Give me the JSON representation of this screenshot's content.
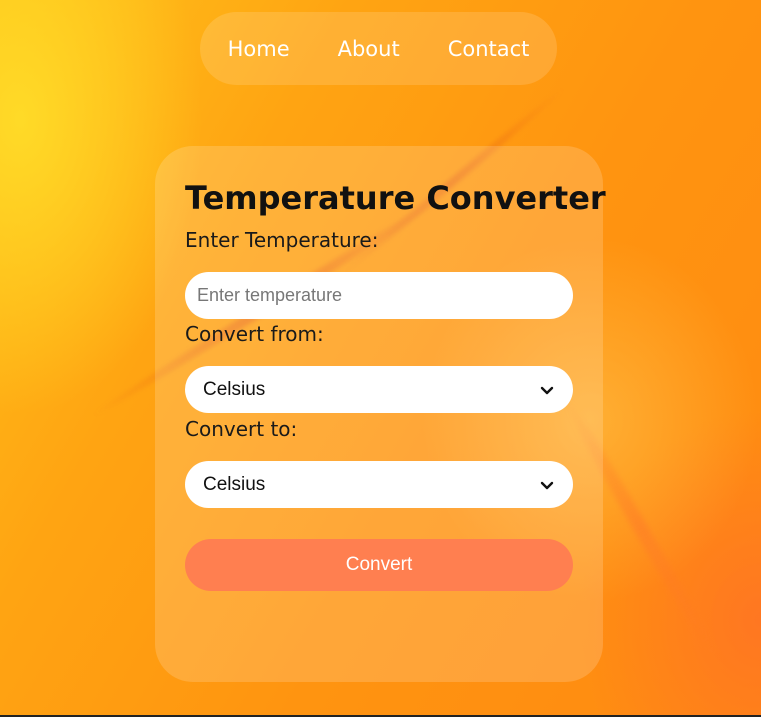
{
  "nav": {
    "items": [
      {
        "label": "Home"
      },
      {
        "label": "About"
      },
      {
        "label": "Contact"
      }
    ]
  },
  "converter": {
    "title": "Temperature Converter",
    "temperature_label": "Enter Temperature:",
    "temperature_input": {
      "value": "",
      "placeholder": "Enter temperature"
    },
    "from_label": "Convert from:",
    "from_select": {
      "selected": "Celsius",
      "icon": "chevron-down-icon"
    },
    "to_label": "Convert to:",
    "to_select": {
      "selected": "Celsius",
      "icon": "chevron-down-icon"
    },
    "convert_button": "Convert"
  },
  "colors": {
    "button_bg": "#ff7f50",
    "background_accent": "#ff9410",
    "text_dark": "#111111"
  }
}
